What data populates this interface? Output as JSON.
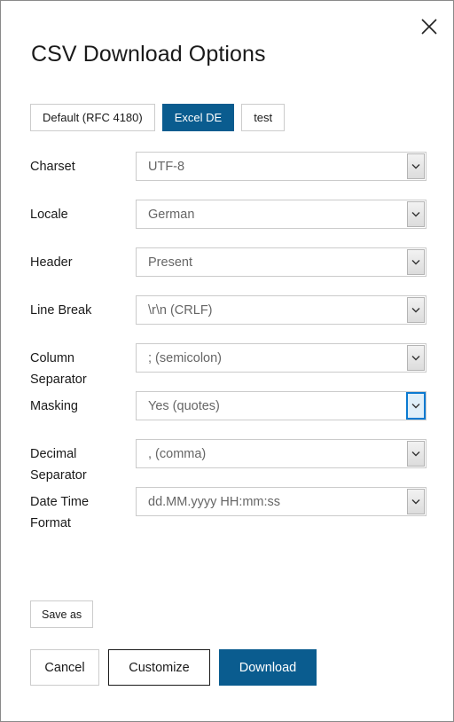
{
  "dialog": {
    "title": "CSV Download Options",
    "close_icon": "close-icon",
    "close_label": "Close"
  },
  "presets": {
    "items": [
      {
        "label": "Default (RFC 4180)",
        "active": false
      },
      {
        "label": "Excel DE",
        "active": true
      },
      {
        "label": "test",
        "active": false
      }
    ]
  },
  "form": {
    "fields": [
      {
        "label": "Charset",
        "value": "UTF-8",
        "focused": false
      },
      {
        "label": "Locale",
        "value": "German",
        "focused": false
      },
      {
        "label": "Header",
        "value": "Present",
        "focused": false
      },
      {
        "label": "Line Break",
        "value": "\\r\\n (CRLF)",
        "focused": false
      },
      {
        "label": "Column Separator",
        "value": "; (semicolon)",
        "focused": false
      },
      {
        "label": "Masking",
        "value": "Yes (quotes)",
        "focused": true
      },
      {
        "label": "Decimal Separator",
        "value": ", (comma)",
        "focused": false
      },
      {
        "label": "Date Time Format",
        "value": "dd.MM.yyyy HH:mm:ss",
        "focused": false
      }
    ]
  },
  "actions": {
    "save_as": "Save as",
    "cancel": "Cancel",
    "customize": "Customize",
    "download": "Download"
  },
  "colors": {
    "accent": "#0a5c8f",
    "focus_border": "#0a7ad1",
    "focus_fill": "#e0eff9",
    "border": "#cccccc",
    "select_border": "#cbcbcb",
    "label_text": "#1a1a1a",
    "value_text": "#666666",
    "dialog_border": "#8a8a8a"
  }
}
